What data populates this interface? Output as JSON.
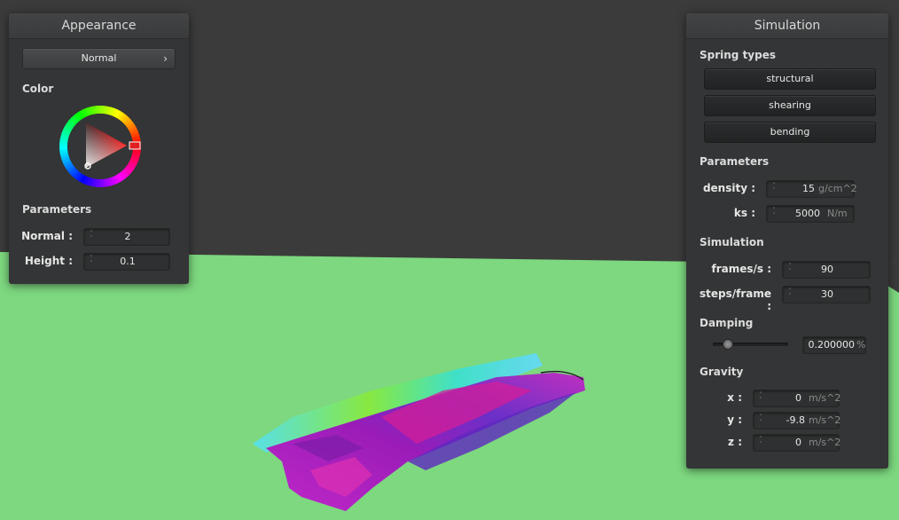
{
  "appearance": {
    "title": "Appearance",
    "shader_select": "Normal",
    "color_label": "Color",
    "parameters_label": "Parameters",
    "normal_label": "Normal :",
    "normal_value": "2",
    "height_label": "Height :",
    "height_value": "0.1"
  },
  "simulation": {
    "title": "Simulation",
    "spring_types_label": "Spring types",
    "spring_buttons": [
      "structural",
      "shearing",
      "bending"
    ],
    "parameters_label": "Parameters",
    "density_label": "density :",
    "density_value": "15",
    "density_unit": "g/cm^2",
    "ks_label": "ks :",
    "ks_value": "5000",
    "ks_unit": "N/m",
    "simulation_label": "Simulation",
    "fps_label": "frames/s :",
    "fps_value": "90",
    "steps_label": "steps/frame :",
    "steps_value": "30",
    "damping_label": "Damping",
    "damping_value": "0.200000",
    "damping_unit": "%",
    "damping_level": 0.2,
    "gravity_label": "Gravity",
    "gx_label": "x :",
    "gx_value": "0",
    "gy_label": "y :",
    "gy_value": "-9.8",
    "gz_label": "z :",
    "gz_value": "0",
    "gravity_unit": "m/s^2"
  },
  "colors": {
    "sky": "#3b3b3b",
    "floor": "#7dd87f",
    "panel": "#343536",
    "cloth_primary": "#b01ec0"
  }
}
